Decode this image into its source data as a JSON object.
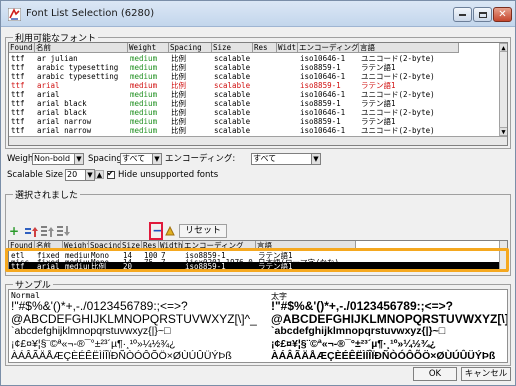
{
  "window": {
    "title": "Font List Selection (6280)",
    "buttons": {
      "minimize": "minimize",
      "maximize": "maximize",
      "close": "close"
    }
  },
  "available_fonts": {
    "group_label": "利用可能なフォント",
    "columns": [
      "Foundr▲",
      "名前",
      "Weight",
      "Spacing",
      "Size",
      "Res",
      "Widt",
      "エンコーディング",
      "言語"
    ],
    "rows": [
      {
        "foundry": "ttf",
        "name": "ar julian",
        "weight": "medium",
        "spacing": "比例",
        "size": "scalable",
        "enc": "iso10646-1",
        "lang": "ユニコード(2-byte)",
        "color": ""
      },
      {
        "foundry": "ttf",
        "name": "arabic typesetting",
        "weight": "medium",
        "spacing": "比例",
        "size": "scalable",
        "enc": "iso8859-1",
        "lang": "ラテン語1",
        "color": ""
      },
      {
        "foundry": "ttf",
        "name": "arabic typesetting",
        "weight": "medium",
        "spacing": "比例",
        "size": "scalable",
        "enc": "iso10646-1",
        "lang": "ユニコード(2-byte)",
        "color": ""
      },
      {
        "foundry": "ttf",
        "name": "arial",
        "weight": "medium",
        "spacing": "比例",
        "size": "scalable",
        "enc": "iso8859-1",
        "lang": "ラテン語1",
        "color": "red"
      },
      {
        "foundry": "ttf",
        "name": "arial",
        "weight": "medium",
        "spacing": "比例",
        "size": "scalable",
        "enc": "iso10646-1",
        "lang": "ユニコード(2-byte)",
        "color": ""
      },
      {
        "foundry": "ttf",
        "name": "arial black",
        "weight": "medium",
        "spacing": "比例",
        "size": "scalable",
        "enc": "iso8859-1",
        "lang": "ラテン語1",
        "color": ""
      },
      {
        "foundry": "ttf",
        "name": "arial black",
        "weight": "medium",
        "spacing": "比例",
        "size": "scalable",
        "enc": "iso10646-1",
        "lang": "ユニコード(2-byte)",
        "color": ""
      },
      {
        "foundry": "ttf",
        "name": "arial narrow",
        "weight": "medium",
        "spacing": "比例",
        "size": "scalable",
        "enc": "iso8859-1",
        "lang": "ラテン語1",
        "color": ""
      },
      {
        "foundry": "ttf",
        "name": "arial narrow",
        "weight": "medium",
        "spacing": "比例",
        "size": "scalable",
        "enc": "iso10646-1",
        "lang": "ユニコード(2-byte)",
        "color": ""
      }
    ]
  },
  "filters": {
    "weight_label": "Weight",
    "weight_value": "Non-bold",
    "spacing_label": "Spacing",
    "spacing_value": "すべて",
    "encoding_label": "エンコーディング:",
    "encoding_value": "すべて",
    "scalable_label": "Scalable Size",
    "scalable_value": "20",
    "hide_label": "Hide unsupported fonts"
  },
  "selected_fonts": {
    "group_label": "選択されました",
    "reset_label": "リセット",
    "columns": [
      "Foundry",
      "名前",
      "Weight",
      "Spacing",
      "Size",
      "Res",
      "Width",
      "エンコーディング",
      "言語"
    ],
    "rows": [
      {
        "foundry": "etl",
        "name": "fixed",
        "weight": "medium",
        "spacing": "Mono",
        "size": "14",
        "res": "100",
        "width": "7",
        "enc": "iso8859-1",
        "lang": "ラテン語1"
      },
      {
        "foundry": "misc",
        "name": "fixed",
        "weight": "medium",
        "spacing": "Mono",
        "size": "14",
        "res": "75",
        "width": "7",
        "enc": "jisx0201.1976-0",
        "lang": "日本語(ローマ字/かな)"
      },
      {
        "foundry": "misc",
        "name": "fixed",
        "weight": "medium",
        "spacing": "Mono",
        "size": "14",
        "res": "75",
        "width": "14",
        "enc": "jisx0208.1983-0",
        "lang": "日本語(漢字)"
      },
      {
        "foundry": "ttf",
        "name": "arial",
        "weight": "medium",
        "spacing": "比例",
        "size": "20",
        "res": "",
        "width": "",
        "enc": "iso8859-1",
        "lang": "ラテン語1"
      }
    ]
  },
  "sample": {
    "group_label": "サンプル",
    "left_caption": "Normal",
    "right_caption": "太字",
    "lines": [
      " !\"#$%&'()*+,-./0123456789:;<=>?",
      "@ABCDEFGHIJKLMNOPQRSTUVWXYZ[\\]^_",
      "`abcdefghijklmnopqrstuvwxyz{|}~□",
      " ¡¢£¤¥¦§¨©ª«¬-®¯°±²³´µ¶·¸¹º»¼½¾¿",
      "ÀÁÂÃÄÅÆÇÈÉÊËÌÍÎÏÐÑÒÓÔÕÖ×ØÙÚÛÜÝÞß"
    ]
  },
  "footer": {
    "ok_label": "OK",
    "cancel_label": "キャンセル"
  }
}
